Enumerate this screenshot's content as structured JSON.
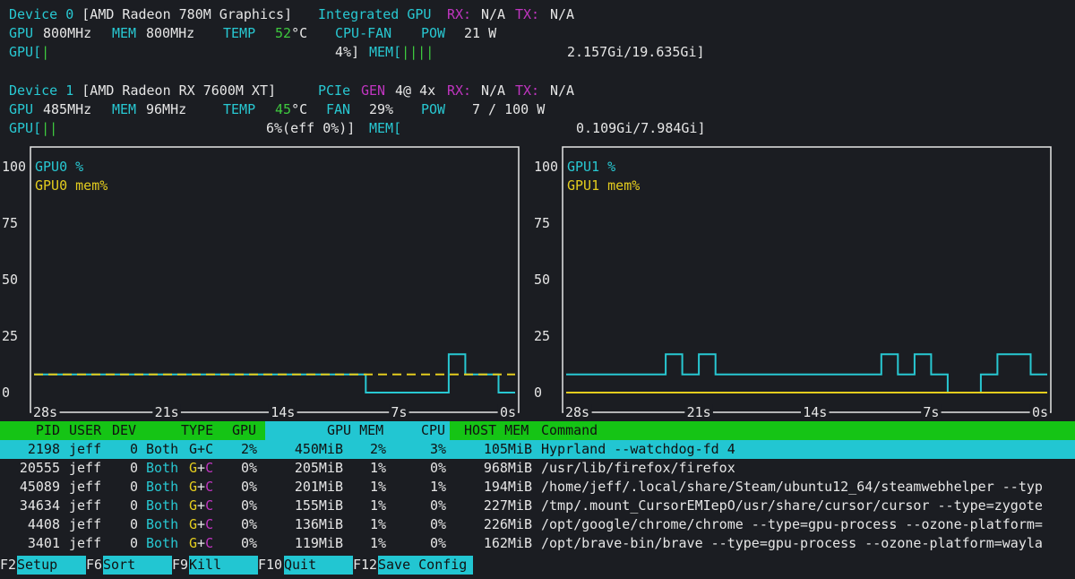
{
  "devices": [
    {
      "title": "Device 0",
      "name": "[AMD Radeon 780M Graphics]",
      "kind": "Integrated GPU",
      "rx_label": "RX:",
      "rx": "N/A",
      "tx_label": "TX:",
      "tx": "N/A",
      "gpu_label": "GPU",
      "gpu_clock": "800MHz",
      "mem_label": "MEM",
      "mem_clock": "800MHz",
      "temp_label": "TEMP",
      "temp_value": "52",
      "temp_unit": "°C",
      "fan_label": "CPU-FAN",
      "pow_label": "POW",
      "pow_value": "21 W",
      "gpu_bar_label": "GPU[",
      "gpu_bar_fill": "|",
      "gpu_bar_text": "4%]",
      "mem_bar_label": "MEM[",
      "mem_bar_fill": "||||",
      "mem_bar_text": "2.157Gi/19.635Gi]"
    },
    {
      "title": "Device 1",
      "name": "[AMD Radeon RX 7600M XT]",
      "pcie_label": "PCIe",
      "gen_label": "GEN",
      "gen_value": "4@ 4x",
      "rx_label": "RX:",
      "rx": "N/A",
      "tx_label": "TX:",
      "tx": "N/A",
      "gpu_label": "GPU",
      "gpu_clock": "485MHz",
      "mem_label": "MEM",
      "mem_clock": "96MHz",
      "temp_label": "TEMP",
      "temp_value": "45",
      "temp_unit": "°C",
      "fan_label": "FAN",
      "fan_value": "29%",
      "pow_label": "POW",
      "pow_value": "7 / 100 W",
      "gpu_bar_label": "GPU[",
      "gpu_bar_fill": "||",
      "gpu_bar_text": "6%(eff 0%)]",
      "mem_bar_label": "MEM[",
      "mem_bar_fill": "",
      "mem_bar_text": "0.109Gi/7.984Gi]"
    }
  ],
  "chart_data": [
    {
      "type": "line",
      "legend": [
        "GPU0 %",
        "GPU0 mem%"
      ],
      "yticks": [
        "100",
        "75",
        "50",
        "25",
        "0"
      ],
      "xticks": [
        "28s",
        "21s",
        "14s",
        "7s",
        "0s"
      ],
      "ylim": [
        0,
        100
      ],
      "xlim": [
        -29,
        0
      ],
      "series": [
        {
          "name": "GPU0 %",
          "color": "#28c8d2",
          "points": [
            [
              -29,
              8
            ],
            [
              -9,
              8
            ],
            [
              -9,
              0
            ],
            [
              -4,
              0
            ],
            [
              -4,
              17
            ],
            [
              -3,
              17
            ],
            [
              -3,
              8
            ],
            [
              -1,
              8
            ],
            [
              -1,
              0
            ],
            [
              0,
              0
            ]
          ]
        },
        {
          "name": "GPU0 mem%",
          "color": "#e3cc1e",
          "points": [
            [
              -29,
              8
            ],
            [
              0,
              8
            ]
          ]
        }
      ]
    },
    {
      "type": "line",
      "legend": [
        "GPU1 %",
        "GPU1 mem%"
      ],
      "yticks": [
        "100",
        "75",
        "50",
        "25",
        "0"
      ],
      "xticks": [
        "28s",
        "21s",
        "14s",
        "7s",
        "0s"
      ],
      "ylim": [
        0,
        100
      ],
      "xlim": [
        -29,
        0
      ],
      "series": [
        {
          "name": "GPU1 %",
          "color": "#28c8d2",
          "points": [
            [
              -29,
              8
            ],
            [
              -23,
              8
            ],
            [
              -23,
              17
            ],
            [
              -22,
              17
            ],
            [
              -22,
              8
            ],
            [
              -21,
              8
            ],
            [
              -21,
              17
            ],
            [
              -20,
              17
            ],
            [
              -20,
              8
            ],
            [
              -10,
              8
            ],
            [
              -10,
              17
            ],
            [
              -9,
              17
            ],
            [
              -9,
              8
            ],
            [
              -8,
              8
            ],
            [
              -8,
              17
            ],
            [
              -7,
              17
            ],
            [
              -7,
              8
            ],
            [
              -6,
              8
            ],
            [
              -6,
              0
            ],
            [
              -5,
              0
            ],
            [
              -4,
              0
            ],
            [
              -4,
              8
            ],
            [
              -3,
              8
            ],
            [
              -3,
              17
            ],
            [
              -1,
              17
            ],
            [
              -1,
              8
            ],
            [
              0,
              8
            ]
          ]
        },
        {
          "name": "GPU1 mem%",
          "color": "#e3cc1e",
          "points": [
            [
              -29,
              0
            ],
            [
              0,
              0
            ]
          ]
        }
      ]
    }
  ],
  "table": {
    "headers": {
      "pid": "PID",
      "user": "USER",
      "dev": "DEV",
      "type": "TYPE",
      "gpu": "GPU",
      "gpumem": "GPU MEM",
      "cpu": "CPU",
      "hostmem": "HOST MEM",
      "command": "Command"
    },
    "rows": [
      {
        "pid": "2198",
        "user": "jeff",
        "dev": "0",
        "type": "Both",
        "g": "G",
        "plus": "+",
        "cc": "C",
        "gpu": "2%",
        "mem": "450MiB",
        "mempct": "2%",
        "cpu": "3%",
        "host": "105MiB",
        "cmd": "Hyprland --watchdog-fd 4"
      },
      {
        "pid": "20555",
        "user": "jeff",
        "dev": "0",
        "type": "Both",
        "g": "G",
        "plus": "+",
        "cc": "C",
        "gpu": "0%",
        "mem": "205MiB",
        "mempct": "1%",
        "cpu": "0%",
        "host": "968MiB",
        "cmd": "/usr/lib/firefox/firefox"
      },
      {
        "pid": "45089",
        "user": "jeff",
        "dev": "0",
        "type": "Both",
        "g": "G",
        "plus": "+",
        "cc": "C",
        "gpu": "0%",
        "mem": "201MiB",
        "mempct": "1%",
        "cpu": "1%",
        "host": "194MiB",
        "cmd": "/home/jeff/.local/share/Steam/ubuntu12_64/steamwebhelper --typ"
      },
      {
        "pid": "34634",
        "user": "jeff",
        "dev": "0",
        "type": "Both",
        "g": "G",
        "plus": "+",
        "cc": "C",
        "gpu": "0%",
        "mem": "155MiB",
        "mempct": "1%",
        "cpu": "0%",
        "host": "227MiB",
        "cmd": "/tmp/.mount_CursorEMIepO/usr/share/cursor/cursor --type=zygote"
      },
      {
        "pid": "4408",
        "user": "jeff",
        "dev": "0",
        "type": "Both",
        "g": "G",
        "plus": "+",
        "cc": "C",
        "gpu": "0%",
        "mem": "136MiB",
        "mempct": "1%",
        "cpu": "0%",
        "host": "226MiB",
        "cmd": "/opt/google/chrome/chrome --type=gpu-process --ozone-platform="
      },
      {
        "pid": "3401",
        "user": "jeff",
        "dev": "0",
        "type": "Both",
        "g": "G",
        "plus": "+",
        "cc": "C",
        "gpu": "0%",
        "mem": "119MiB",
        "mempct": "1%",
        "cpu": "0%",
        "host": "162MiB",
        "cmd": "/opt/brave-bin/brave --type=gpu-process --ozone-platform=wayla"
      }
    ]
  },
  "footer": [
    {
      "key": "F2",
      "label": "Setup"
    },
    {
      "key": "F6",
      "label": "Sort"
    },
    {
      "key": "F9",
      "label": "Kill"
    },
    {
      "key": "F10",
      "label": "Quit"
    },
    {
      "key": "F12",
      "label": "Save Config"
    }
  ]
}
